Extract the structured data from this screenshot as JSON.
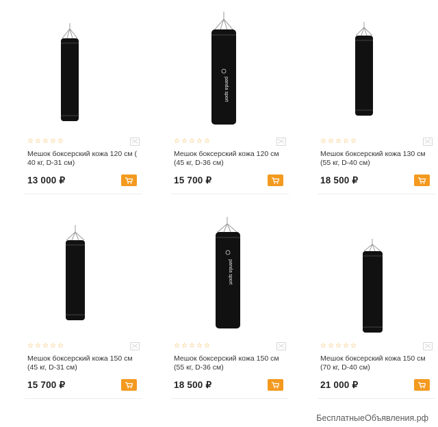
{
  "products": [
    {
      "title": "Мешок боксерский кожа 120 см ( 40 кг, D-31 см)",
      "price": "13 000 ₽",
      "rating": 0,
      "brand_text": ""
    },
    {
      "title": "Мешок боксерский кожа 120 см (45 кг, D-36 см)",
      "price": "15 700 ₽",
      "rating": 0,
      "brand_text": "panda sport"
    },
    {
      "title": "Мешок боксерский кожа 130 см (55 кг, D-40 см)",
      "price": "18 500 ₽",
      "rating": 0,
      "brand_text": ""
    },
    {
      "title": "Мешок боксерский кожа 150 см (45 кг, D-31 см)",
      "price": "15 700 ₽",
      "rating": 0,
      "brand_text": ""
    },
    {
      "title": "Мешок боксерский кожа 150 см (55 кг, D-36 см)",
      "price": "18 500 ₽",
      "rating": 0,
      "brand_text": "panda sport"
    },
    {
      "title": "Мешок боксерский кожа 150 см (70 кг, D-40 см)",
      "price": "21 000 ₽",
      "rating": 0,
      "brand_text": ""
    }
  ],
  "icons": {
    "star": "star-outline-icon",
    "compare": "compare-icon",
    "cart": "cart-icon"
  },
  "colors": {
    "accent": "#f39a1f",
    "star": "#f0a830",
    "bag": "#111111"
  },
  "watermark": "БесплатныеОбъявления.рф"
}
